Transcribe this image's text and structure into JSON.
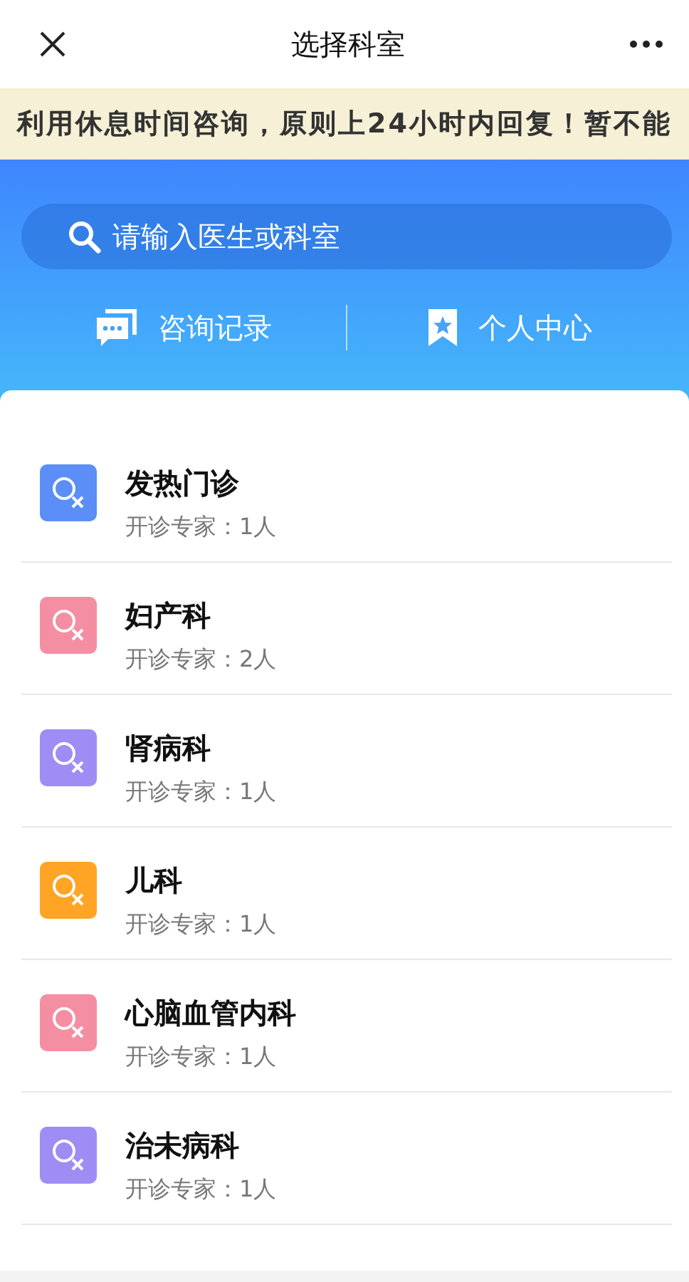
{
  "header": {
    "title": "选择科室"
  },
  "notice": "利用休息时间咨询，原则上24小时内回复！暂不能",
  "search": {
    "placeholder": "请输入医生或科室"
  },
  "links": [
    {
      "kind": "records",
      "label": "咨询记录"
    },
    {
      "kind": "profile",
      "label": "个人中心"
    }
  ],
  "departments": [
    {
      "name": "发热门诊",
      "experts": "开诊专家：1人",
      "color": "#5b8ef6"
    },
    {
      "name": "妇产科",
      "experts": "开诊专家：2人",
      "color": "#f48ea2"
    },
    {
      "name": "肾病科",
      "experts": "开诊专家：1人",
      "color": "#9f8cf4"
    },
    {
      "name": "儿科",
      "experts": "开诊专家：1人",
      "color": "#ffa424"
    },
    {
      "name": "心脑血管内科",
      "experts": "开诊专家：1人",
      "color": "#f48ea2"
    },
    {
      "name": "治未病科",
      "experts": "开诊专家：1人",
      "color": "#9f8cf4"
    }
  ]
}
